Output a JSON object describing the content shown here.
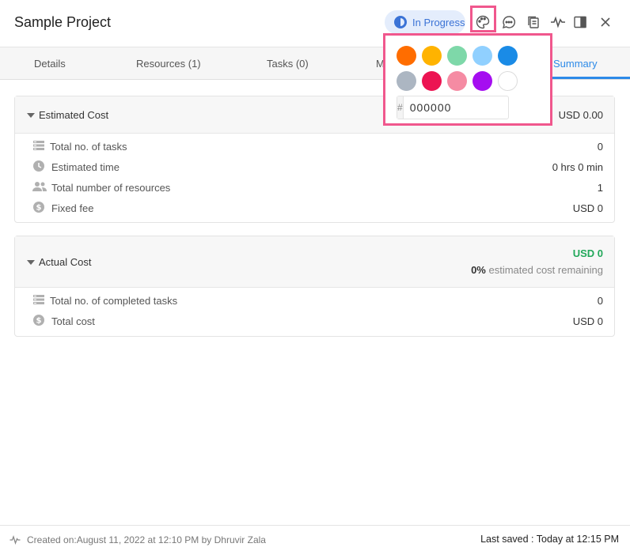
{
  "header": {
    "title": "Sample Project",
    "status_label": "In Progress",
    "icons": [
      "palette-icon",
      "comment-icon",
      "copy-icon",
      "activity-icon",
      "sidebar-panel-icon",
      "close-icon"
    ]
  },
  "tabs": [
    {
      "label": "Details",
      "active": false
    },
    {
      "label": "Resources (1)",
      "active": false
    },
    {
      "label": "Tasks (0)",
      "active": false
    },
    {
      "label": "M",
      "active": false
    },
    {
      "label": "Summary",
      "active": true
    }
  ],
  "estimated_cost": {
    "title": "Estimated Cost",
    "total": "USD 0.00",
    "rows": [
      {
        "icon": "tasks-icon",
        "label": "Total no. of tasks",
        "value": "0"
      },
      {
        "icon": "clock-icon",
        "label": "Estimated time",
        "value": "0 hrs 0 min"
      },
      {
        "icon": "people-icon",
        "label": "Total number of resources",
        "value": "1"
      },
      {
        "icon": "dollar-icon",
        "label": "Fixed fee",
        "value": "USD 0"
      }
    ]
  },
  "actual_cost": {
    "title": "Actual Cost",
    "total": "USD 0",
    "percent": "0%",
    "remaining_text": "estimated cost remaining",
    "rows": [
      {
        "icon": "tasks-icon",
        "label": "Total no. of completed tasks",
        "value": "0"
      },
      {
        "icon": "dollar-icon",
        "label": "Total cost",
        "value": "USD 0"
      }
    ]
  },
  "color_picker": {
    "swatches": [
      "#ff6d00",
      "#ffb300",
      "#7ed8a9",
      "#90d0ff",
      "#1a8be6",
      "#acb6c2",
      "#ec1452",
      "#f58ba3",
      "#a50ef0",
      "#ffffff"
    ],
    "hex_prefix": "#",
    "hex_value": "000000"
  },
  "footer": {
    "created": "Created on:August 11, 2022 at 12:10 PM by Dhruvir Zala",
    "last_saved": "Last saved : Today at 12:15 PM"
  },
  "colors": {
    "accent": "#2d8ae8",
    "status_bg": "#e4edfc",
    "status_text": "#3b73d6",
    "highlight": "#f0578d",
    "positive": "#22a85a"
  }
}
